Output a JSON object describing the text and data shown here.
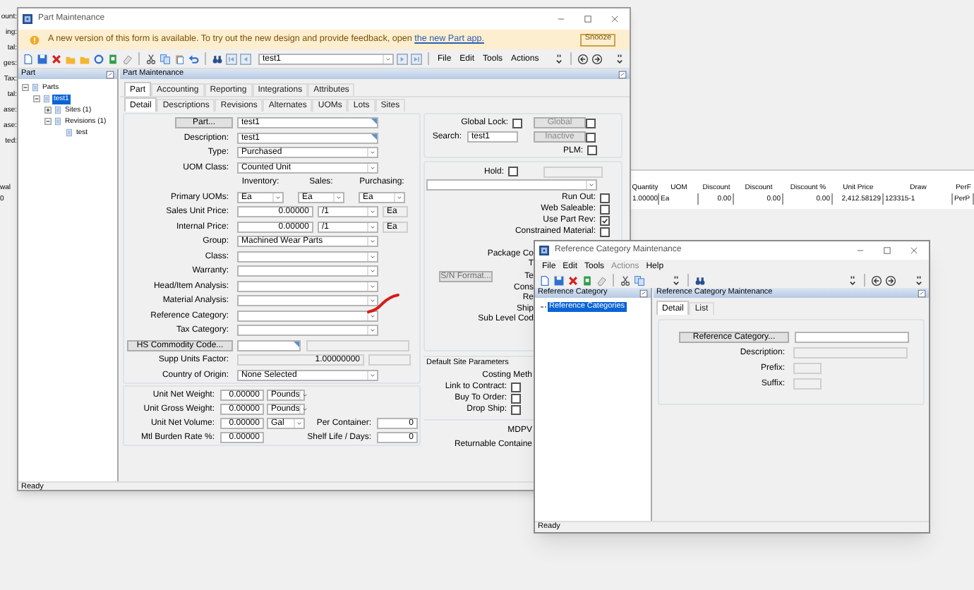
{
  "background": {
    "side_labels": [
      "ount:",
      "ing:",
      "tal:",
      "ges:",
      "Tax:",
      "tal:",
      "ase:",
      "ase:",
      "ted:"
    ],
    "lower_labels": [
      "wal",
      "0"
    ],
    "grid": {
      "columns": [
        "Quantity",
        "UOM",
        "Discount",
        "Discount",
        "Discount %",
        "Unit Price",
        "Draw",
        "PerF"
      ],
      "rows": [
        [
          "1.00000",
          "Ea",
          "0.00",
          "0.00",
          "0.00",
          "2,412.58129",
          "123315-1",
          "PerP"
        ]
      ]
    }
  },
  "part_window": {
    "title": "Part Maintenance",
    "banner": {
      "message": "A new version of this form is available. To try out the new design and provide feedback, open ",
      "link": "the new Part app.",
      "button": "Snooze"
    },
    "toolbar": {
      "search_value": "test1",
      "menus": [
        "File",
        "Edit",
        "Tools",
        "Actions"
      ]
    },
    "tree": {
      "header": "Part",
      "items": [
        {
          "label": "Parts",
          "selected": false,
          "expanded": true,
          "children": [
            {
              "label": "test1",
              "selected": true,
              "expanded": true,
              "children": [
                {
                  "label": "Sites (1)",
                  "selected": false,
                  "expanded": false
                },
                {
                  "label": "Revisions (1)",
                  "selected": false,
                  "expanded": true,
                  "children": [
                    {
                      "label": "test",
                      "selected": false
                    }
                  ]
                }
              ]
            }
          ]
        }
      ]
    },
    "panel_title": "Part Maintenance",
    "tabs": [
      {
        "label": "Part",
        "selected": true
      },
      {
        "label": "Accounting",
        "selected": false
      },
      {
        "label": "Reporting",
        "selected": false
      },
      {
        "label": "Integrations",
        "selected": false
      },
      {
        "label": "Attributes",
        "selected": false
      }
    ],
    "subtabs": [
      {
        "label": "Detail",
        "selected": true
      },
      {
        "label": "Descriptions",
        "selected": false
      },
      {
        "label": "Revisions",
        "selected": false
      },
      {
        "label": "Alternates",
        "selected": false
      },
      {
        "label": "UOMs",
        "selected": false
      },
      {
        "label": "Lots",
        "selected": false
      },
      {
        "label": "Sites",
        "selected": false
      }
    ],
    "main_form": [
      {
        "kind": "button_field",
        "button": "Part...",
        "value": "test1"
      },
      {
        "kind": "text",
        "label": "Description:",
        "value": "test1"
      },
      {
        "kind": "combo",
        "label": "Type:",
        "value": "Purchased"
      },
      {
        "kind": "combo",
        "label": "UOM Class:",
        "value": "Counted Unit"
      },
      {
        "kind": "headers",
        "values": [
          "Inventory:",
          "Sales:",
          "Purchasing:"
        ]
      },
      {
        "kind": "uoms",
        "label": "Primary UOMs:",
        "values": [
          "Ea",
          "Ea",
          "Ea"
        ]
      },
      {
        "kind": "price",
        "label": "Sales Unit Price:",
        "value": "0.00000",
        "per": "/1",
        "uom": "Ea"
      },
      {
        "kind": "price",
        "label": "Internal Price:",
        "value": "0.00000",
        "per": "/1",
        "uom": "Ea"
      },
      {
        "kind": "combo",
        "label": "Group:",
        "value": "Machined Wear Parts"
      },
      {
        "kind": "combo",
        "label": "Class:"
      },
      {
        "kind": "combo",
        "label": "Warranty:"
      },
      {
        "kind": "combo",
        "label": "Head/Item Analysis:"
      },
      {
        "kind": "combo",
        "label": "Material Analysis:"
      },
      {
        "kind": "combo",
        "label": "Reference Category:"
      },
      {
        "kind": "combo",
        "label": "Tax Category:"
      },
      {
        "kind": "lookup",
        "button": "HS Commodity Code..."
      },
      {
        "kind": "factor",
        "label": "Supp Units Factor:",
        "value": "1.00000000"
      },
      {
        "kind": "combo",
        "label": "Country of Origin:",
        "value": "None Selected"
      }
    ],
    "weights": [
      {
        "label": "Unit Net Weight:",
        "value": "0.00000",
        "uom": "Pounds"
      },
      {
        "label": "Unit Gross Weight:",
        "value": "0.00000",
        "uom": "Pounds"
      },
      {
        "label": "Unit Net Volume:",
        "value": "0.00000",
        "uom": "Gal",
        "side_label": "Per Container:",
        "side_value": "0"
      },
      {
        "label": "Mtl Burden Rate %:",
        "value": "0.00000",
        "side_label": "Shelf Life / Days:",
        "side_value": "0"
      }
    ],
    "global": {
      "lock_label": "Global Lock:",
      "lock_checked": false,
      "global_button": "Global",
      "global_checked": false,
      "search_label": "Search:",
      "search_value": "test1",
      "inactive_button": "Inactive",
      "inactive_checked": false,
      "plm_label": "PLM:",
      "plm_checked": false
    },
    "hold": {
      "label": "Hold:",
      "checked": false
    },
    "flags": [
      {
        "label": "Run Out:",
        "checked": false
      },
      {
        "label": "Web Saleable:",
        "checked": false
      },
      {
        "label": "Use Part Rev:",
        "checked": true
      },
      {
        "label": "Constrained Material:",
        "checked": false
      }
    ],
    "sn_button": {
      "label": "S/N Format...",
      "disabled": true
    },
    "cut_labels": [
      "Package Co",
      "T",
      "Te",
      "Cons",
      "Re",
      "Ship",
      "Sub Level Cod"
    ],
    "site_parameters": {
      "title": "Default Site Parameters",
      "costing_label": "Costing Meth",
      "checks": [
        {
          "label": "Link to Contract:",
          "checked": false
        },
        {
          "label": "Buy To Order:",
          "checked": false
        },
        {
          "label": "Drop Ship:",
          "checked": false
        }
      ],
      "bottom_labels": [
        "MDPV",
        "Returnable Containe"
      ]
    },
    "status_bar": "Ready"
  },
  "reference_window": {
    "title": "Reference Category Maintenance",
    "menus": [
      {
        "label": "File",
        "disabled": false
      },
      {
        "label": "Edit",
        "disabled": false
      },
      {
        "label": "Tools",
        "disabled": false
      },
      {
        "label": "Actions",
        "disabled": true
      },
      {
        "label": "Help",
        "disabled": false
      }
    ],
    "tree_header": "Reference Category",
    "tree_items": [
      {
        "label": "Reference Categories",
        "selected": true
      }
    ],
    "panel_title": "Reference Category Maintenance",
    "tabs": [
      {
        "label": "Detail",
        "selected": true
      },
      {
        "label": "List",
        "selected": false
      }
    ],
    "form": [
      {
        "kind": "button_field",
        "button": "Reference Category..."
      },
      {
        "kind": "text",
        "label": "Description:"
      },
      {
        "kind": "short",
        "label": "Prefix:"
      },
      {
        "kind": "short",
        "label": "Suffix:"
      }
    ],
    "status_bar": "Ready"
  }
}
